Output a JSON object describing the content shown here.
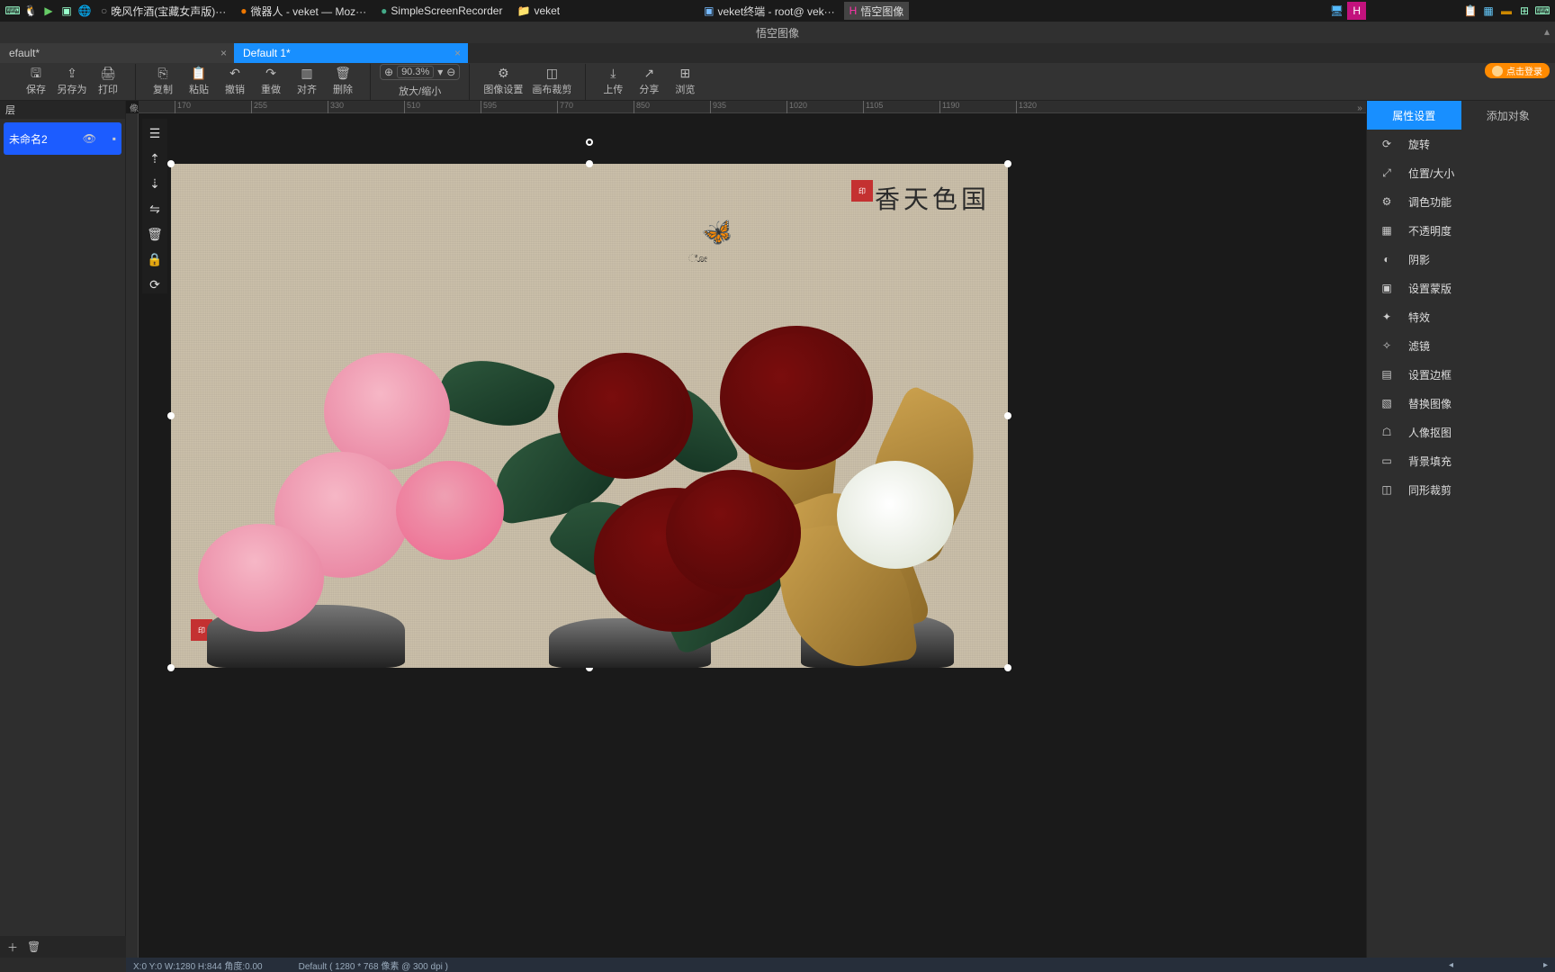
{
  "taskbar": {
    "items": [
      {
        "label": "晚风作酒(宝藏女声版)···",
        "icon": "●"
      },
      {
        "label": "微器人 - veket — Moz···",
        "icon": "🦊"
      },
      {
        "label": "SimpleScreenRecorder",
        "icon": "●"
      },
      {
        "label": "veket",
        "icon": "📁"
      },
      {
        "label": "veket终端 - root@ vek···",
        "icon": ">_"
      },
      {
        "label": "悟空图像",
        "icon": "H"
      }
    ]
  },
  "window": {
    "title": "悟空图像",
    "minimize": "–"
  },
  "doc_tabs": [
    {
      "label": "efault*",
      "active": false
    },
    {
      "label": "Default 1*",
      "active": true
    }
  ],
  "toolbar": {
    "save": "保存",
    "saveas": "另存为",
    "print": "打印",
    "copy": "复制",
    "paste": "粘贴",
    "undo": "撤销",
    "redo": "重做",
    "align": "对齐",
    "delete": "删除",
    "zoom_val": "90.3%",
    "zoom_label": "放大/缩小",
    "imgset": "图像设置",
    "crop": "画布裁剪",
    "upload": "上传",
    "share": "分享",
    "browse": "浏览"
  },
  "login": "点击登录",
  "layers": {
    "header": "层",
    "smallhdr": "像素",
    "item": "未命名2",
    "add": "＋",
    "del": "🗑"
  },
  "ruler_ticks": [
    "170",
    "255",
    "330",
    "510",
    "595",
    "770",
    "850",
    "935",
    "1020",
    "1105",
    "1190",
    "1320"
  ],
  "right": {
    "tab_attr": "属性设置",
    "tab_add": "添加对象",
    "items": [
      {
        "icon": "⟳",
        "label": "旋转"
      },
      {
        "icon": "⤢",
        "label": "位置/大小"
      },
      {
        "icon": "⚙",
        "label": "调色功能"
      },
      {
        "icon": "▦",
        "label": "不透明度"
      },
      {
        "icon": "◐",
        "label": "阴影"
      },
      {
        "icon": "▣",
        "label": "设置蒙版"
      },
      {
        "icon": "✦",
        "label": "特效"
      },
      {
        "icon": "✧",
        "label": "滤镜"
      },
      {
        "icon": "▤",
        "label": "设置边框"
      },
      {
        "icon": "▧",
        "label": "替换图像"
      },
      {
        "icon": "☖",
        "label": "人像抠图"
      },
      {
        "icon": "▭",
        "label": "背景填充"
      },
      {
        "icon": "◫",
        "label": "同形裁剪"
      }
    ]
  },
  "canvas": {
    "calligraphy": "香天色国",
    "seal1": "印",
    "seal2": "印"
  },
  "status": {
    "left": "X:0 Y:0 W:1280 H:844 角度:0.00",
    "mid": "Default ( 1280 * 768 像素 @ 300 dpi )"
  }
}
